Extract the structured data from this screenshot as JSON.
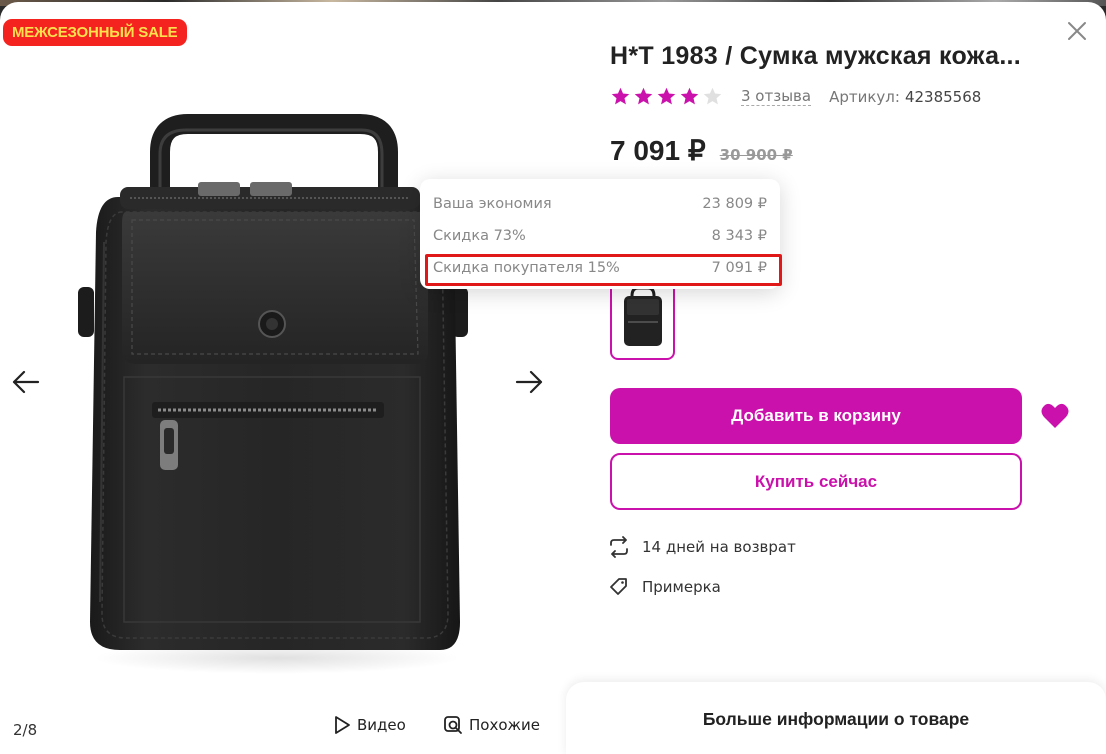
{
  "modal": {
    "badge": "МЕЖСЕЗОННЫЙ SALE",
    "close_icon": "close-icon"
  },
  "gallery": {
    "counter": "2/8",
    "video_label": "Видео",
    "similar_label": "Похожие",
    "prev_icon": "arrow-left-icon",
    "next_icon": "arrow-right-icon"
  },
  "product": {
    "title": "H*T 1983 / Сумка мужская кожа...",
    "rating": 4,
    "rating_max": 5,
    "reviews": "3 отзыва",
    "sku_label": "Артикул:",
    "sku": "42385568",
    "price": "7 091 ₽",
    "old_price": "30 900 ₽"
  },
  "discount_popup": {
    "rows": [
      {
        "label": "Ваша экономия",
        "value": "23 809 ₽"
      },
      {
        "label": "Скидка 73%",
        "value": "8 343 ₽"
      },
      {
        "label": "Скидка покупателя 15%",
        "value": "7 091 ₽"
      }
    ],
    "highlighted_row": 2
  },
  "actions": {
    "add_to_cart": "Добавить в корзину",
    "buy_now": "Купить сейчас",
    "favorite_icon": "heart-icon"
  },
  "info": {
    "return": "14 дней на возврат",
    "fitting": "Примерка"
  },
  "footer": {
    "more_info": "Больше информации о товаре"
  },
  "colors": {
    "accent": "#cb11ab",
    "star": "#cb11ab",
    "badge_bg": "#f5231f",
    "badge_text": "#ffe14d",
    "highlight": "#e01818"
  }
}
